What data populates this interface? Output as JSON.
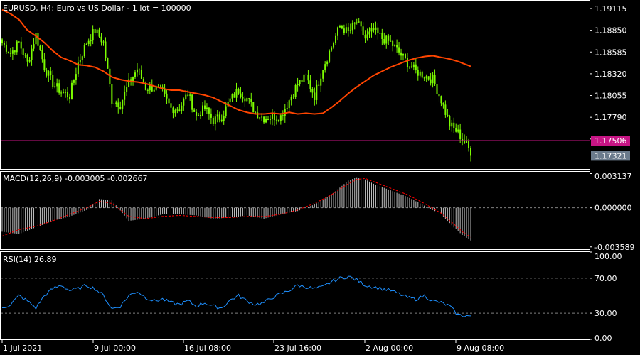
{
  "window": {
    "symbol": "EURUSD",
    "timeframe": "H4",
    "description": "Euro vs US Dollar - 1 lot = 100000",
    "title": "EURUSD, H4:  Euro vs US Dollar - 1 lot = 100000"
  },
  "colors": {
    "background": "#000000",
    "frame": "#ffffff",
    "candle": "#7CFC00",
    "moving_average": "#FF4500",
    "hline": "#C71585",
    "price_tag_bid": "#C71585",
    "price_tag_ask": "#6B7B8C",
    "macd_histogram": "#C0C0C0",
    "macd_signal": "#FF0000",
    "rsi_line": "#1E90FF",
    "dotted_levels": "#808080"
  },
  "time_axis": [
    "1 Jul 2021",
    "9 Jul 00:00",
    "16 Jul 08:00",
    "23 Jul 16:00",
    "2 Aug 00:00",
    "9 Aug 08:00"
  ],
  "chart_data": [
    {
      "type": "candlestick",
      "panel": "price",
      "title": "EURUSD, H4:  Euro vs US Dollar - 1 lot = 100000",
      "ylim": [
        1.1716,
        1.1921
      ],
      "y_ticks": [
        "1.19115",
        "1.18850",
        "1.18585",
        "1.18320",
        "1.18055",
        "1.17790",
        "1.17525"
      ],
      "price_tags": [
        {
          "label": "1.17506",
          "value": 1.17506,
          "color": "#C71585"
        },
        {
          "label": "1.17321",
          "value": 1.17321,
          "color": "#6B7B8C"
        }
      ],
      "x_tick_labels": [
        "1 Jul 2021",
        "9 Jul 00:00",
        "16 Jul 08:00",
        "23 Jul 16:00",
        "2 Aug 00:00",
        "9 Aug 08:00"
      ],
      "close_keypoints": [
        [
          0,
          1.187
        ],
        [
          4,
          1.1857
        ],
        [
          8,
          1.187
        ],
        [
          12,
          1.1845
        ],
        [
          16,
          1.188
        ],
        [
          20,
          1.184
        ],
        [
          24,
          1.182
        ],
        [
          28,
          1.181
        ],
        [
          32,
          1.1805
        ],
        [
          36,
          1.1845
        ],
        [
          40,
          1.187
        ],
        [
          44,
          1.1885
        ],
        [
          48,
          1.187
        ],
        [
          52,
          1.18
        ],
        [
          56,
          1.1795
        ],
        [
          60,
          1.182
        ],
        [
          64,
          1.1838
        ],
        [
          68,
          1.1815
        ],
        [
          72,
          1.1815
        ],
        [
          76,
          1.1808
        ],
        [
          80,
          1.179
        ],
        [
          84,
          1.179
        ],
        [
          88,
          1.1808
        ],
        [
          92,
          1.178
        ],
        [
          96,
          1.179
        ],
        [
          100,
          1.1775
        ],
        [
          104,
          1.178
        ],
        [
          108,
          1.18
        ],
        [
          112,
          1.1812
        ],
        [
          116,
          1.1802
        ],
        [
          120,
          1.1785
        ],
        [
          124,
          1.1778
        ],
        [
          128,
          1.178
        ],
        [
          132,
          1.178
        ],
        [
          136,
          1.18
        ],
        [
          140,
          1.182
        ],
        [
          144,
          1.1828
        ],
        [
          148,
          1.1805
        ],
        [
          152,
          1.184
        ],
        [
          156,
          1.1865
        ],
        [
          160,
          1.189
        ],
        [
          164,
          1.1882
        ],
        [
          168,
          1.1895
        ],
        [
          172,
          1.1875
        ],
        [
          176,
          1.1885
        ],
        [
          180,
          1.1875
        ],
        [
          184,
          1.187
        ],
        [
          188,
          1.1858
        ],
        [
          192,
          1.1845
        ],
        [
          196,
          1.1835
        ],
        [
          200,
          1.183
        ],
        [
          204,
          1.1825
        ],
        [
          208,
          1.18
        ],
        [
          212,
          1.177
        ],
        [
          216,
          1.176
        ],
        [
          220,
          1.1745
        ],
        [
          222,
          1.1737
        ]
      ],
      "series": [
        {
          "name": "",
          "type": "moving_average",
          "values_keypoints": [
            [
              0,
              1.191
            ],
            [
              4,
              1.1905
            ],
            [
              8,
              1.1898
            ],
            [
              12,
              1.1885
            ],
            [
              16,
              1.1878
            ],
            [
              20,
              1.187
            ],
            [
              24,
              1.186
            ],
            [
              28,
              1.1852
            ],
            [
              32,
              1.1848
            ],
            [
              36,
              1.1843
            ],
            [
              40,
              1.1842
            ],
            [
              44,
              1.184
            ],
            [
              48,
              1.1835
            ],
            [
              52,
              1.1828
            ],
            [
              56,
              1.1825
            ],
            [
              60,
              1.1823
            ],
            [
              64,
              1.1822
            ],
            [
              68,
              1.182
            ],
            [
              72,
              1.1817
            ],
            [
              76,
              1.1814
            ],
            [
              80,
              1.1812
            ],
            [
              84,
              1.1812
            ],
            [
              88,
              1.181
            ],
            [
              92,
              1.1808
            ],
            [
              96,
              1.1806
            ],
            [
              100,
              1.1803
            ],
            [
              104,
              1.1798
            ],
            [
              108,
              1.1793
            ],
            [
              112,
              1.1788
            ],
            [
              116,
              1.1785
            ],
            [
              120,
              1.1783
            ],
            [
              124,
              1.1783
            ],
            [
              128,
              1.1784
            ],
            [
              132,
              1.1783
            ],
            [
              136,
              1.1785
            ],
            [
              140,
              1.1783
            ],
            [
              144,
              1.1784
            ],
            [
              148,
              1.1783
            ],
            [
              152,
              1.1784
            ],
            [
              156,
              1.1791
            ],
            [
              160,
              1.1799
            ],
            [
              164,
              1.1808
            ],
            [
              168,
              1.1816
            ],
            [
              172,
              1.1823
            ],
            [
              176,
              1.183
            ],
            [
              180,
              1.1835
            ],
            [
              184,
              1.184
            ],
            [
              188,
              1.1844
            ],
            [
              192,
              1.1848
            ],
            [
              196,
              1.1851
            ],
            [
              200,
              1.1853
            ],
            [
              204,
              1.1854
            ],
            [
              208,
              1.1852
            ],
            [
              212,
              1.185
            ],
            [
              216,
              1.1847
            ],
            [
              220,
              1.1843
            ],
            [
              222,
              1.1841
            ]
          ]
        }
      ],
      "horizontal_lines": [
        1.17506
      ]
    },
    {
      "type": "histogram+line",
      "panel": "macd",
      "label": "MACD(12,26,9) -0.003005 -0.002667",
      "ylim": [
        -0.0038,
        0.0033
      ],
      "y_ticks": [
        "0.003137",
        "0.000000",
        "-0.003589"
      ],
      "zero_level": 0.0,
      "histogram_keypoints": [
        [
          0,
          -0.0022
        ],
        [
          8,
          -0.0024
        ],
        [
          16,
          -0.0018
        ],
        [
          24,
          -0.0012
        ],
        [
          32,
          -0.0008
        ],
        [
          40,
          -0.0002
        ],
        [
          46,
          0.0008
        ],
        [
          52,
          0.0007
        ],
        [
          60,
          -0.0012
        ],
        [
          68,
          -0.001
        ],
        [
          76,
          -0.0006
        ],
        [
          84,
          -0.0006
        ],
        [
          92,
          -0.0007
        ],
        [
          100,
          -0.001
        ],
        [
          108,
          -0.0009
        ],
        [
          116,
          -0.0007
        ],
        [
          124,
          -0.001
        ],
        [
          132,
          -0.0006
        ],
        [
          140,
          -0.0003
        ],
        [
          148,
          0.0003
        ],
        [
          156,
          0.0012
        ],
        [
          164,
          0.0025
        ],
        [
          168,
          0.0028
        ],
        [
          172,
          0.0026
        ],
        [
          176,
          0.0022
        ],
        [
          184,
          0.0016
        ],
        [
          192,
          0.001
        ],
        [
          200,
          0.0002
        ],
        [
          208,
          -0.0006
        ],
        [
          214,
          -0.0018
        ],
        [
          218,
          -0.0025
        ],
        [
          222,
          -0.003
        ]
      ],
      "signal_keypoints": [
        [
          0,
          -0.0026
        ],
        [
          8,
          -0.002
        ],
        [
          16,
          -0.0017
        ],
        [
          24,
          -0.0012
        ],
        [
          32,
          -0.0006
        ],
        [
          40,
          0.0
        ],
        [
          46,
          0.0006
        ],
        [
          52,
          0.0004
        ],
        [
          60,
          -0.0008
        ],
        [
          68,
          -0.001
        ],
        [
          76,
          -0.0008
        ],
        [
          84,
          -0.0007
        ],
        [
          92,
          -0.0008
        ],
        [
          100,
          -0.0009
        ],
        [
          108,
          -0.0009
        ],
        [
          116,
          -0.0008
        ],
        [
          124,
          -0.0008
        ],
        [
          132,
          -0.0006
        ],
        [
          140,
          -0.0002
        ],
        [
          148,
          0.0004
        ],
        [
          156,
          0.0012
        ],
        [
          164,
          0.0022
        ],
        [
          168,
          0.0026
        ],
        [
          172,
          0.0027
        ],
        [
          176,
          0.0024
        ],
        [
          184,
          0.0018
        ],
        [
          192,
          0.0012
        ],
        [
          200,
          0.0004
        ],
        [
          208,
          -0.0005
        ],
        [
          214,
          -0.0015
        ],
        [
          218,
          -0.0022
        ],
        [
          222,
          -0.0027
        ]
      ]
    },
    {
      "type": "line",
      "panel": "rsi",
      "label": "RSI(14) 26.89",
      "ylim": [
        0,
        100
      ],
      "y_ticks": [
        "100.00",
        "70.00",
        "30.00",
        "0.00"
      ],
      "levels": [
        70,
        30
      ],
      "values_keypoints": [
        [
          0,
          36
        ],
        [
          4,
          40
        ],
        [
          8,
          50
        ],
        [
          12,
          44
        ],
        [
          16,
          36
        ],
        [
          20,
          50
        ],
        [
          24,
          58
        ],
        [
          28,
          62
        ],
        [
          32,
          56
        ],
        [
          36,
          58
        ],
        [
          40,
          62
        ],
        [
          44,
          58
        ],
        [
          48,
          50
        ],
        [
          52,
          35
        ],
        [
          56,
          38
        ],
        [
          60,
          50
        ],
        [
          64,
          55
        ],
        [
          68,
          48
        ],
        [
          72,
          44
        ],
        [
          76,
          46
        ],
        [
          80,
          42
        ],
        [
          84,
          40
        ],
        [
          88,
          44
        ],
        [
          92,
          38
        ],
        [
          96,
          42
        ],
        [
          100,
          38
        ],
        [
          104,
          36
        ],
        [
          108,
          45
        ],
        [
          112,
          50
        ],
        [
          116,
          44
        ],
        [
          120,
          40
        ],
        [
          124,
          42
        ],
        [
          128,
          48
        ],
        [
          132,
          52
        ],
        [
          136,
          56
        ],
        [
          140,
          62
        ],
        [
          144,
          60
        ],
        [
          148,
          58
        ],
        [
          152,
          60
        ],
        [
          156,
          66
        ],
        [
          160,
          70
        ],
        [
          164,
          72
        ],
        [
          168,
          68
        ],
        [
          172,
          62
        ],
        [
          176,
          60
        ],
        [
          180,
          58
        ],
        [
          184,
          56
        ],
        [
          188,
          52
        ],
        [
          192,
          48
        ],
        [
          196,
          46
        ],
        [
          200,
          50
        ],
        [
          204,
          44
        ],
        [
          208,
          42
        ],
        [
          212,
          38
        ],
        [
          216,
          28
        ],
        [
          220,
          27
        ],
        [
          222,
          26.89
        ]
      ]
    }
  ]
}
